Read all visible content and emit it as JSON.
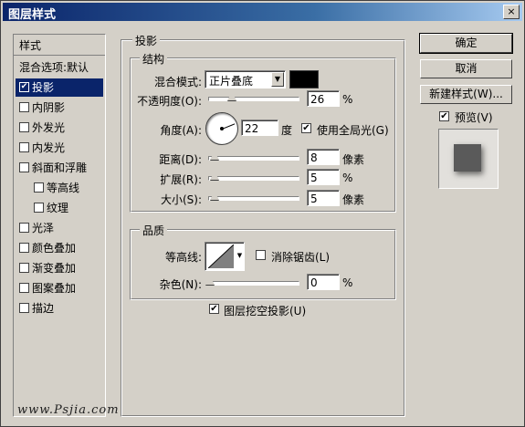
{
  "window": {
    "title": "图层样式",
    "close": "×"
  },
  "stylelist": {
    "header": "样式",
    "items": [
      {
        "label": "混合选项:默认",
        "checkbox": false,
        "checked": false,
        "selected": false,
        "indent": false
      },
      {
        "label": "投影",
        "checkbox": true,
        "checked": true,
        "selected": true,
        "indent": false
      },
      {
        "label": "内阴影",
        "checkbox": true,
        "checked": false,
        "selected": false,
        "indent": false
      },
      {
        "label": "外发光",
        "checkbox": true,
        "checked": false,
        "selected": false,
        "indent": false
      },
      {
        "label": "内发光",
        "checkbox": true,
        "checked": false,
        "selected": false,
        "indent": false
      },
      {
        "label": "斜面和浮雕",
        "checkbox": true,
        "checked": false,
        "selected": false,
        "indent": false
      },
      {
        "label": "等高线",
        "checkbox": true,
        "checked": false,
        "selected": false,
        "indent": true
      },
      {
        "label": "纹理",
        "checkbox": true,
        "checked": false,
        "selected": false,
        "indent": true
      },
      {
        "label": "光泽",
        "checkbox": true,
        "checked": false,
        "selected": false,
        "indent": false
      },
      {
        "label": "颜色叠加",
        "checkbox": true,
        "checked": false,
        "selected": false,
        "indent": false
      },
      {
        "label": "渐变叠加",
        "checkbox": true,
        "checked": false,
        "selected": false,
        "indent": false
      },
      {
        "label": "图案叠加",
        "checkbox": true,
        "checked": false,
        "selected": false,
        "indent": false
      },
      {
        "label": "描边",
        "checkbox": true,
        "checked": false,
        "selected": false,
        "indent": false
      }
    ]
  },
  "watermark": "www.Psjia.com",
  "drop_shadow": {
    "group_title": "投影",
    "structure": {
      "title": "结构",
      "blend_mode_label": "混合模式:",
      "blend_mode_value": "正片叠底",
      "shadow_color": "#000000",
      "opacity_label": "不透明度(O):",
      "opacity_value": "26",
      "opacity_unit": "%",
      "opacity_fraction": 0.26,
      "angle_label": "角度(A):",
      "angle_value": "22",
      "angle_unit": "度",
      "global_light_label": "使用全局光(G)",
      "global_light_checked": true,
      "distance_label": "距离(D):",
      "distance_value": "8",
      "distance_unit": "像素",
      "spread_label": "扩展(R):",
      "spread_value": "5",
      "spread_unit": "%",
      "size_label": "大小(S):",
      "size_value": "5",
      "size_unit": "像素"
    },
    "quality": {
      "title": "品质",
      "contour_label": "等高线:",
      "anti_alias_label": "消除锯齿(L)",
      "anti_alias_checked": false,
      "noise_label": "杂色(N):",
      "noise_value": "0",
      "noise_unit": "%"
    },
    "knockout_label": "图层挖空投影(U)",
    "knockout_checked": true
  },
  "buttons": {
    "ok": "确定",
    "cancel": "取消",
    "new_style": "新建样式(W)..."
  },
  "preview": {
    "label": "预览(V)",
    "checked": true
  },
  "icons": {
    "checkmark": "✔",
    "dropdown": "▼"
  }
}
